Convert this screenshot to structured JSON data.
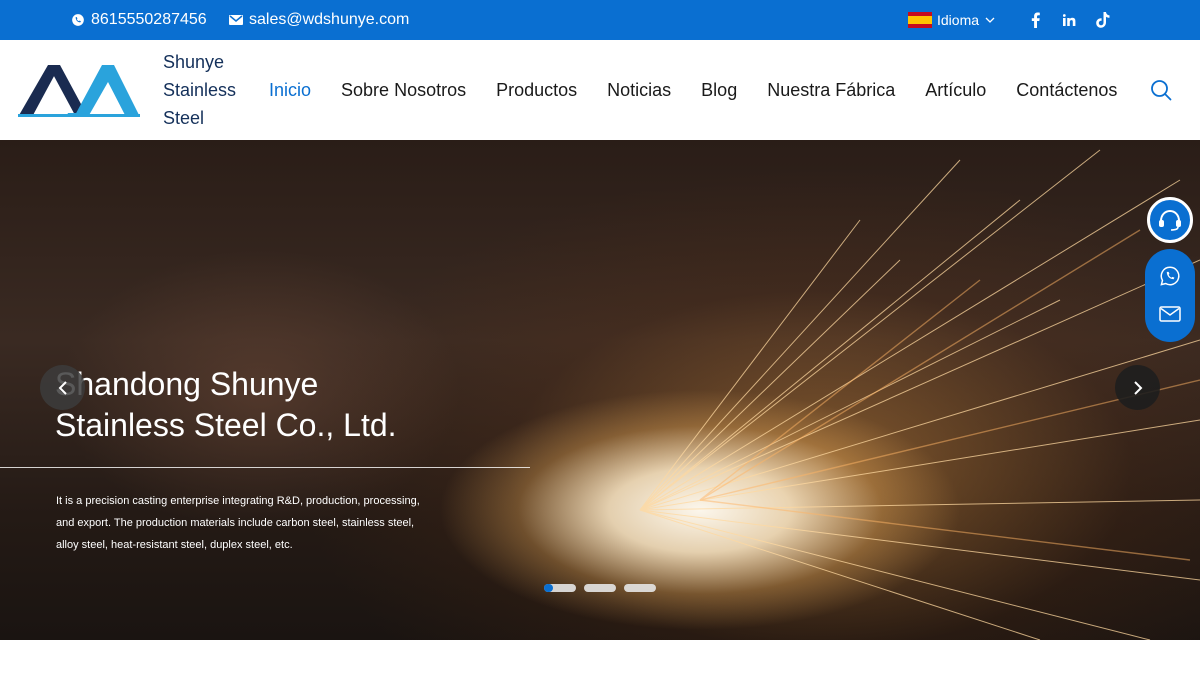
{
  "topbar": {
    "phone": "8615550287456",
    "email": "sales@wdshunye.com",
    "language_label": "Idioma",
    "icons": [
      "whatsapp-icon",
      "mail-icon",
      "flag-es-icon",
      "chevron-down-icon",
      "facebook-icon",
      "linkedin-icon",
      "tiktok-icon"
    ]
  },
  "header": {
    "brand_line1": "Shunye",
    "brand_line2": "Stainless",
    "brand_line3": "Steel",
    "nav": [
      "Inicio",
      "Sobre Nosotros",
      "Productos",
      "Noticias",
      "Blog",
      "Nuestra Fábrica",
      "Artículo",
      "Contáctenos"
    ],
    "active_nav": "Inicio"
  },
  "hero": {
    "title_line1": "Shandong Shunye",
    "title_line2": "Stainless Steel Co., Ltd.",
    "description": "It is a precision casting enterprise integrating R&D, production, processing, and export. The production materials include carbon steel, stainless steel, alloy steel, heat-resistant steel, duplex steel, etc.",
    "slides_count": 3,
    "active_slide": 1
  },
  "colors": {
    "accent": "#0a6fd1",
    "brand_text": "#14305a",
    "logo_dark": "#1a2b50",
    "logo_light": "#2aa3dc"
  }
}
